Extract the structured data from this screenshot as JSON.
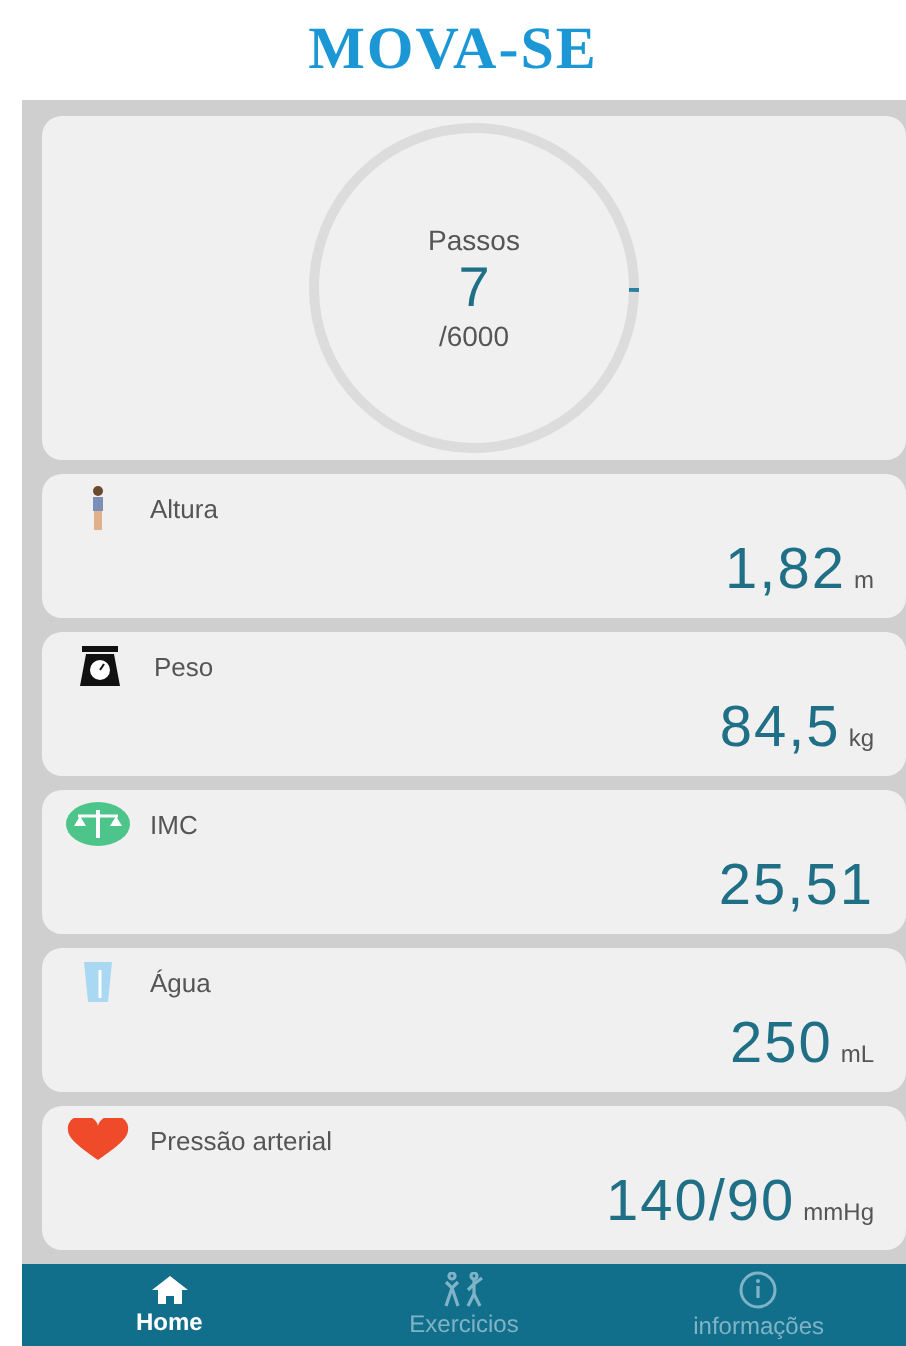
{
  "app_title": "MOVA-SE",
  "steps": {
    "label": "Passos",
    "count": "7",
    "goal": "/6000",
    "level": 0.0012
  },
  "metrics": [
    {
      "kind": "height",
      "label": "Altura",
      "value": "1,82",
      "unit": "m"
    },
    {
      "kind": "weight",
      "label": "Peso",
      "value": "84,5",
      "unit": "kg"
    },
    {
      "kind": "bmi",
      "label": "IMC",
      "value": "25,51"
    },
    {
      "kind": "water",
      "label": "Água",
      "value": "250",
      "unit": "mL"
    },
    {
      "kind": "pressure",
      "label": "Pressão arterial",
      "value": "140/90",
      "unit": "mmHg"
    }
  ],
  "nav": [
    {
      "kind": "home",
      "label": "Home",
      "selected": true
    },
    {
      "kind": "exercise",
      "label": "Exercicios",
      "selected": false
    },
    {
      "kind": "info",
      "label": "informações",
      "selected": false
    }
  ]
}
